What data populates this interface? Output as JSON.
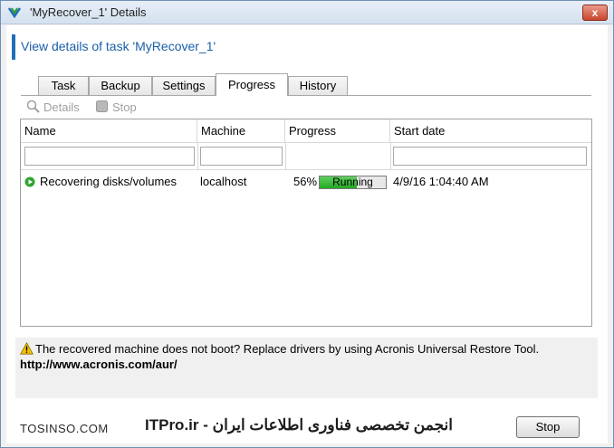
{
  "window": {
    "title": "'MyRecover_1' Details",
    "close_label": "x"
  },
  "header": {
    "title": "View details of task 'MyRecover_1'"
  },
  "tabs": [
    {
      "label": "Task"
    },
    {
      "label": "Backup"
    },
    {
      "label": "Settings"
    },
    {
      "label": "Progress"
    },
    {
      "label": "History"
    }
  ],
  "active_tab": "Progress",
  "toolbar": {
    "details_label": "Details",
    "stop_label": "Stop"
  },
  "table": {
    "columns": [
      "Name",
      "Machine",
      "Progress",
      "Start date"
    ],
    "rows": [
      {
        "name": "Recovering disks/volumes",
        "machine": "localhost",
        "percent": "56%",
        "progress_value": 0.56,
        "status": "Running",
        "start_date": "4/9/16 1:04:40 AM"
      }
    ]
  },
  "info": {
    "message": "The recovered machine does not boot? Replace drivers by using Acronis Universal Restore Tool.",
    "link": "http://www.acronis.com/aur/"
  },
  "footer": {
    "left_text": "TOSINSO.COM",
    "center_text": "ITPro.ir - انجمن تخصصی فناوری اطلاعات ایران",
    "stop_button": "Stop"
  },
  "colors": {
    "accent": "#1e6fb8",
    "progress": "#24a824",
    "warning": "#f2c200"
  }
}
